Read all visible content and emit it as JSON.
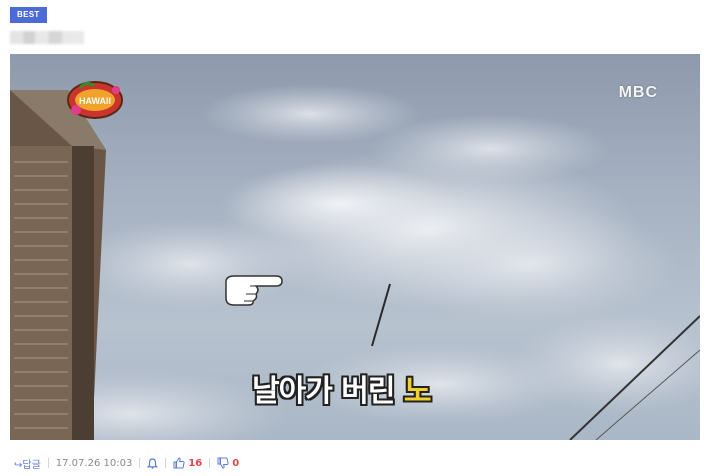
{
  "post": {
    "badge": "BEST",
    "media": {
      "channel_logo": "MBC",
      "show_logo_text": "HAWAII",
      "caption_main": "날아가 버린 ",
      "caption_highlight": "노",
      "pointer_icon": "pointing-hand-icon"
    },
    "meta": {
      "reply_label": "↪답글",
      "timestamp": "17.07.26 10:03",
      "alert_icon": "bell-icon",
      "like_count": "16",
      "dislike_count": "0"
    },
    "colors": {
      "badge": "#4b6bd6",
      "reply": "#5b7bd8",
      "vote": "#e0454b",
      "caption_highlight": "#f2cf2a"
    }
  }
}
